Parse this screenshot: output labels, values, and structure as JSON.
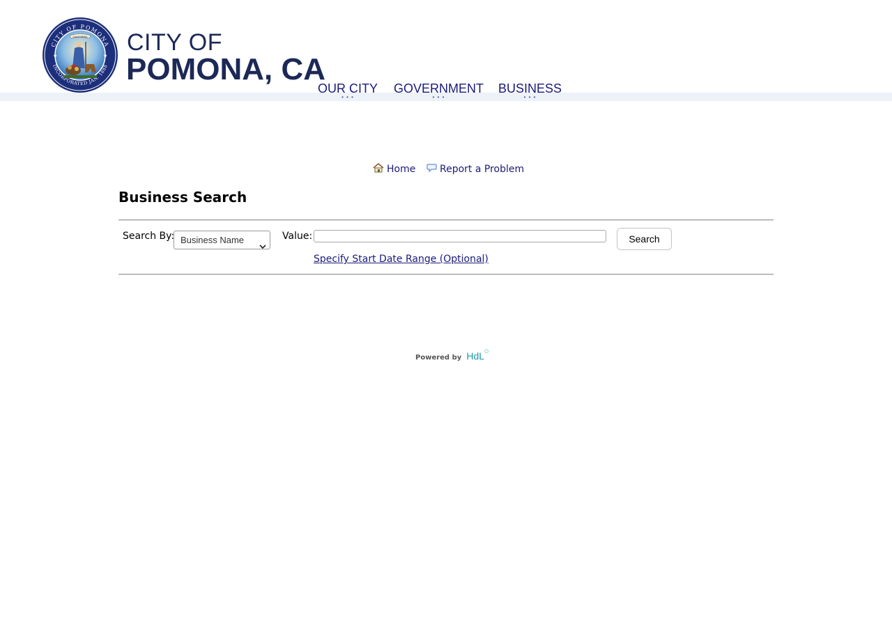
{
  "header": {
    "brand_line1": "CITY OF",
    "brand_line2": "POMONA, CA",
    "seal": {
      "ring_text_top": "CITY OF POMONA",
      "ring_text_bottom": "INCORPORATED JAN. 1888",
      "ribbon": "CALIFORNIA"
    },
    "nav": [
      {
        "label": "OUR CITY"
      },
      {
        "label": "GOVERNMENT"
      },
      {
        "label": "BUSINESS"
      }
    ]
  },
  "toplinks": {
    "home": "Home",
    "report": "Report a Problem"
  },
  "main": {
    "title": "Business Search",
    "search_by_label": "Search By:",
    "search_by_value": "Business Name",
    "value_label": "Value:",
    "value_input": "",
    "search_button": "Search",
    "date_range_link": "Specify Start Date Range (Optional)"
  },
  "footer": {
    "powered_by": "Powered by",
    "brand": "HdL"
  },
  "colors": {
    "nav_text": "#1a1a7a",
    "brand_navy": "#1c2957",
    "header_band": "#edf1f8",
    "link": "#1a1a7a",
    "hdl_teal": "#1b9aa0"
  }
}
